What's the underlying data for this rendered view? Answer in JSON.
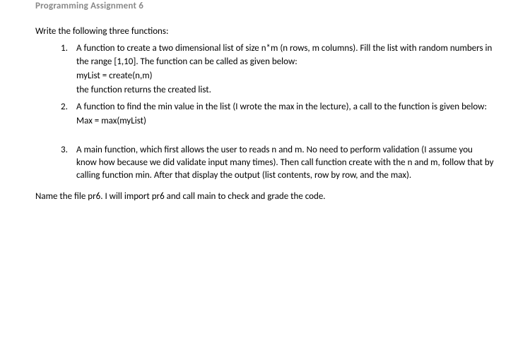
{
  "title": "Programming Assignment 6",
  "intro": "Write the following three functions:",
  "items": [
    {
      "num": "1.",
      "lines": [
        "A function to create a two dimensional list of size n*m (n rows, m columns). Fill the list with random numbers in the range [1,10]. The function can be called as given below:",
        "myList = create(n,m)",
        "the function returns the created list."
      ]
    },
    {
      "num": "2.",
      "lines": [
        "A function to find the min value in the list (I wrote the max in the lecture), a call to the function is given below:",
        "Max = max(myList)"
      ]
    },
    {
      "num": "3.",
      "lines": [
        "A main function, which first allows the user to reads n and m. No need to perform validation (I assume you know how because we did validate input many times). Then call function create with the n and m, follow that by calling function min. After that display the output (list contents, row by row, and the max)."
      ]
    }
  ],
  "closing": "Name the file pr6. I will import pr6 and call main to check and grade the code."
}
